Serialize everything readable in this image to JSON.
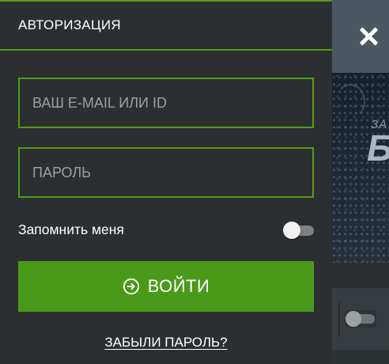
{
  "modal": {
    "title": "АВТОРИЗАЦИЯ",
    "email_placeholder": "ВАШ E-MAIL ИЛИ ID",
    "email_value": "",
    "password_placeholder": "ПАРОЛЬ",
    "password_value": "",
    "remember_label": "Запомнить меня",
    "remember_enabled": false,
    "login_label": "ВОЙТИ",
    "login_icon": "login-icon",
    "forgot_label": "ЗАБЫЛИ ПАРОЛЬ?"
  },
  "background": {
    "hero_subtitle": "ЗА",
    "hero_title": "Б",
    "close_icon": "close-icon"
  },
  "colors": {
    "accent_green": "#4a9a1a",
    "panel_bg": "#2b2f31",
    "text": "#ffffff",
    "placeholder": "#9aa0a4"
  }
}
